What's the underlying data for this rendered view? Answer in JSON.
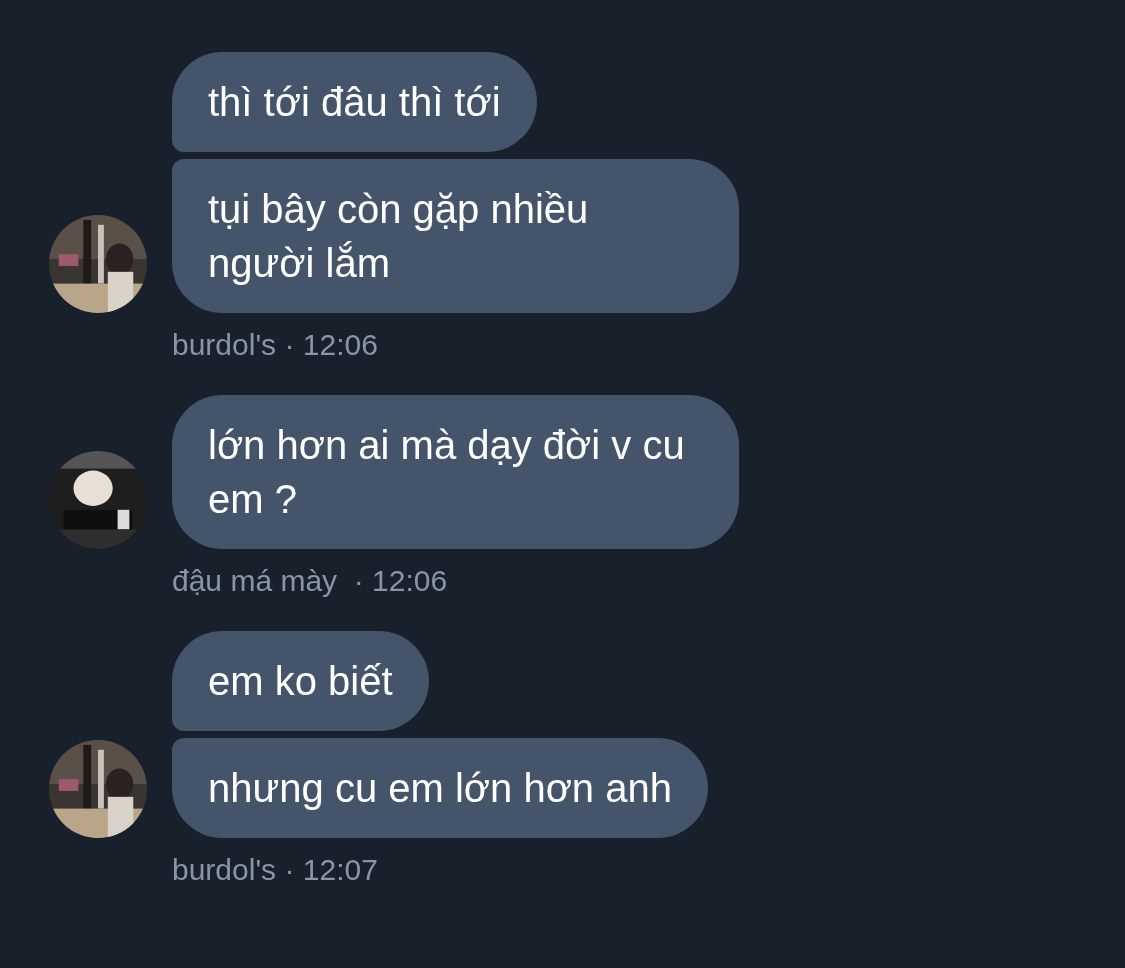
{
  "groups": [
    {
      "avatar": {
        "kind": "picture"
      },
      "messages": [
        "thì tới đâu thì tới",
        "tụi bây còn gặp nhiều người lắm"
      ],
      "meta": "burdol's · 12:06"
    },
    {
      "avatar": {
        "kind": "picture"
      },
      "messages": [
        "lớn hơn ai mà dạy đời v cu em ?"
      ],
      "meta": "đậu má mày  · 12:06"
    },
    {
      "avatar": {
        "kind": "picture"
      },
      "messages": [
        "em ko biết",
        "nhưng cu em lớn hơn anh"
      ],
      "meta": "burdol's · 12:07"
    }
  ]
}
